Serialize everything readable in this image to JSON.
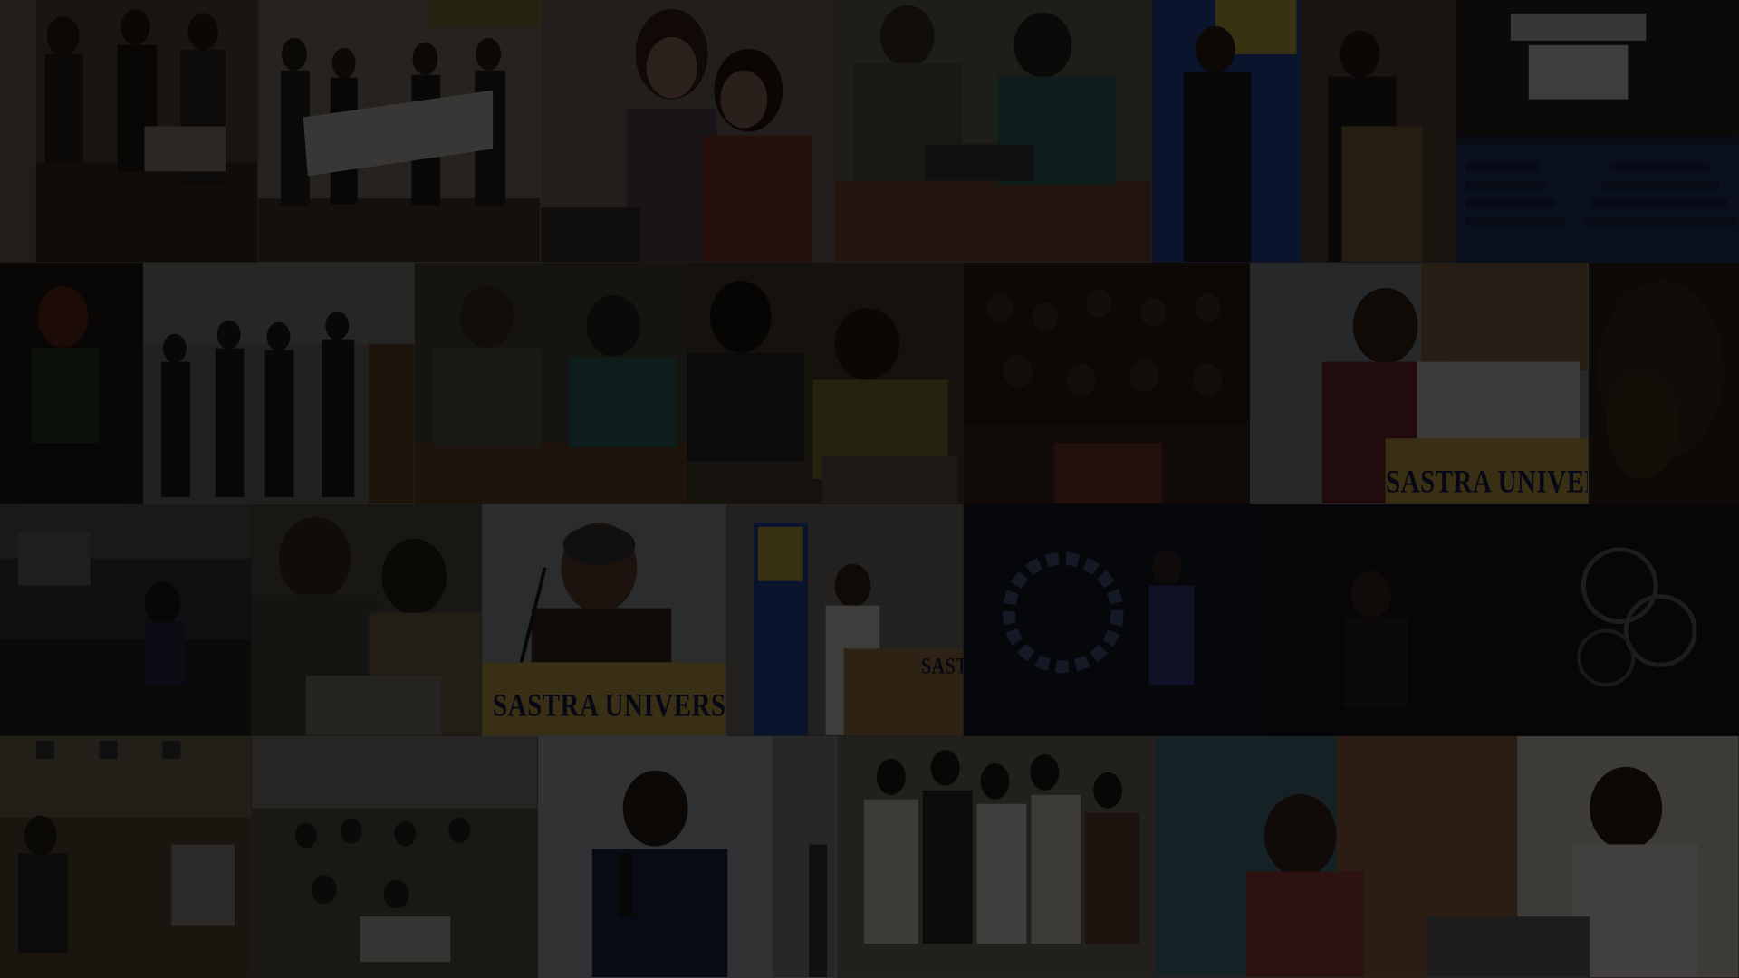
{
  "collage": {
    "overlay_color": "#000000",
    "overlay_opacity": 0.72,
    "photos": [
      {
        "id": "row1-group-with-cheque",
        "tone": "#6b5a47"
      },
      {
        "id": "row1-team-holding-cheque",
        "tone": "#8a7a66"
      },
      {
        "id": "row1-participants-smiling",
        "tone": "#7a5f52"
      },
      {
        "id": "row1-coders-on-floor",
        "tone": "#6a6c5e"
      },
      {
        "id": "row1-speaker-with-banner",
        "tone": "#3a4a6a"
      },
      {
        "id": "row1-auditorium-stage",
        "tone": "#2a3550"
      },
      {
        "id": "row2-person-in-dark",
        "tone": "#4a2a2a"
      },
      {
        "id": "row2-team-standing",
        "tone": "#6c6a66"
      },
      {
        "id": "row2-group-working",
        "tone": "#4e4a3e"
      },
      {
        "id": "row2-laptop-session",
        "tone": "#5a4d3a"
      },
      {
        "id": "row2-crowd-hall",
        "tone": "#3e2a22"
      },
      {
        "id": "row2-speaker-at-podium",
        "tone": "#8a8c94"
      },
      {
        "id": "row2-outdoor-foliage",
        "tone": "#3a2a1e"
      },
      {
        "id": "row3-classroom",
        "tone": "#3e3c44"
      },
      {
        "id": "row3-discussion",
        "tone": "#5a5446"
      },
      {
        "id": "row3-chief-guest",
        "tone": "#9aa0a6"
      },
      {
        "id": "row3-podium-banner",
        "tone": "#5a5a3a"
      },
      {
        "id": "row3-stage-performance",
        "tone": "#1e2a44"
      },
      {
        "id": "row3-hoop-performance",
        "tone": "#23212a"
      },
      {
        "id": "row4-presenter-room",
        "tone": "#6a5a40"
      },
      {
        "id": "row4-workshop-hall",
        "tone": "#5e5a52"
      },
      {
        "id": "row4-speaker-mic",
        "tone": "#b4b8bc"
      },
      {
        "id": "row4-group-huddle",
        "tone": "#7a7468"
      },
      {
        "id": "row4-colorful-room",
        "tone": "#8e7a70"
      }
    ],
    "signs": [
      {
        "text": "SASTRA UNIVERSITY",
        "color": "#1b1f4a"
      },
      {
        "text": "SASTRA UNIVERSITY",
        "color": "#1b1f4a"
      },
      {
        "text": "SASTRA",
        "color": "#1b1f4a"
      }
    ]
  }
}
